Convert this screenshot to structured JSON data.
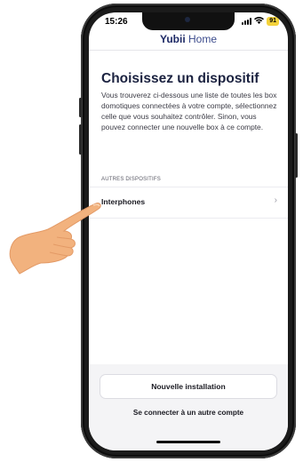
{
  "status_bar": {
    "time": "15:26",
    "battery": "91"
  },
  "header": {
    "brand_bold": "Yubii",
    "brand_light": " Home"
  },
  "page": {
    "title": "Choisissez un dispositif",
    "description": "Vous trouverez ci-dessous une liste de toutes les box domotiques connectées à votre compte, sélectionnez celle que vous souhaitez contrôler. Sinon, vous pouvez connecter une nouvelle box à ce compte."
  },
  "section": {
    "label": "AUTRES DISPOSITIFS",
    "items": [
      {
        "label": "Interphones",
        "chevron": "›"
      }
    ]
  },
  "actions": {
    "primary_label": "Nouvelle installation",
    "secondary_label": "Se connecter à un autre compte"
  },
  "icons": {
    "wifi": "wifi-icon",
    "chevron": "chevron-right-icon",
    "pointer": "pointing-hand-icon"
  },
  "colors": {
    "brand": "#1e2a66",
    "battery": "#f4d23b",
    "skin": "#f2b27e"
  }
}
